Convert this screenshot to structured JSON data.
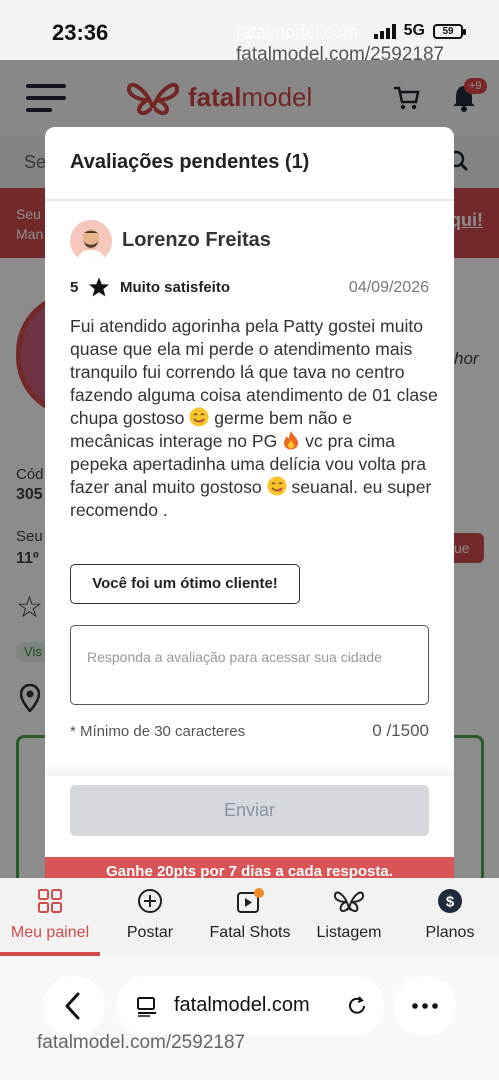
{
  "status_bar": {
    "time": "23:36",
    "network": "5G",
    "battery": "59",
    "watermark_top_light": "fatalmodel.com",
    "watermark_top": "fatalmodel.com/2592187"
  },
  "app_header": {
    "logo_text_bold": "fatal",
    "logo_text": "model",
    "notification_count": "+9"
  },
  "background": {
    "search_fragment": "Se",
    "red_line1": "Seu",
    "red_line2": "Man",
    "red_link": "qui!",
    "frag_cod": "Cód",
    "frag_305": "305",
    "frag_seu": "Seu",
    "frag_11": "11º",
    "frag_hor": "hor",
    "frag_vis": "Vis",
    "frag_ue": "ue"
  },
  "modal": {
    "title": "Avaliações pendentes (1)",
    "reviewer_name": "Lorenzo Freitas",
    "rating": "5",
    "rating_label": "Muito satisfeito",
    "date": "04/09/2026",
    "review_part1": "Fui atendido agorinha pela Patty gostei muito quase que ela mi perde o atendimento mais tranquilo fui correndo lá que tava no centro fazendo alguma coisa atendimento de 01 clase chupa gostoso ",
    "review_part2": " germe bem não e mecânicas interage no PG ",
    "review_part3": " vc pra cima pepeka apertadinha uma delícia vou volta pra fazer anal muito gostoso ",
    "review_part4": " seuanal. eu super recomendo .",
    "good_client_badge": "Você foi um ótimo cliente!",
    "reply_placeholder": "Responda a avaliação para acessar sua cidade",
    "min_chars": "* Mínimo de 30 caracteres",
    "char_count": "0 /1500",
    "send_label": "Enviar",
    "promo": "Ganhe 20pts por 7 dias a cada resposta."
  },
  "bottom_nav": {
    "items": [
      {
        "label": "Meu painel"
      },
      {
        "label": "Postar"
      },
      {
        "label": "Fatal Shots"
      },
      {
        "label": "Listagem"
      },
      {
        "label": "Planos"
      }
    ]
  },
  "browser": {
    "url": "fatalmodel.com",
    "watermark_bottom": "fatalmodel.com/2592187"
  },
  "colors": {
    "brand": "#d24c4c",
    "send_disabled": "#d5d9dd"
  }
}
